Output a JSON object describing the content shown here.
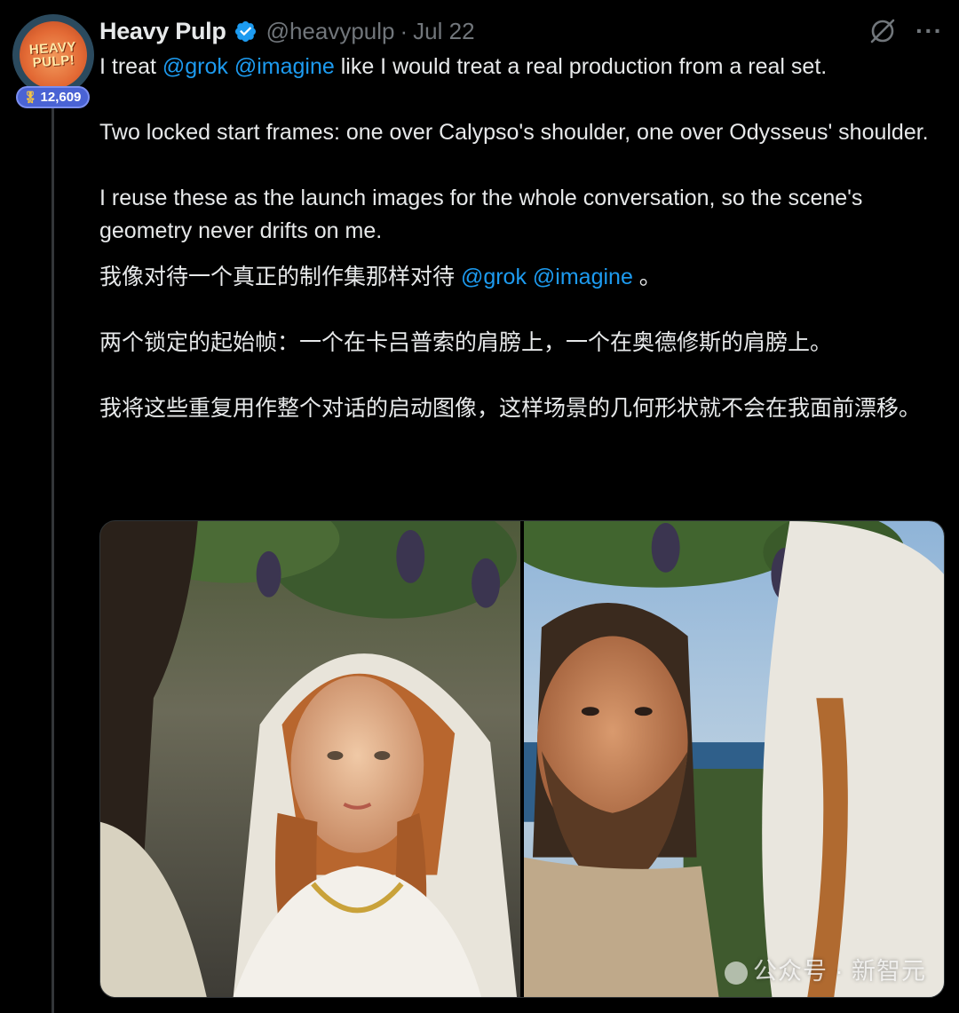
{
  "author": {
    "avatar_text_line1": "HEAVY",
    "avatar_text_line2": "PULP!",
    "name": "Heavy Pulp",
    "handle": "@heavypulp",
    "separator": "·",
    "date": "Jul 22",
    "badge_count": "12,609"
  },
  "icons": {
    "verified": "verified-badge-icon",
    "grok": "grok-icon",
    "more": "more-options-icon",
    "badge": "medal-icon"
  },
  "tweet": {
    "en_line1_pre": "I treat ",
    "mention_grok": "@grok",
    "mention_space": " ",
    "mention_imagine": "@imagine",
    "en_line1_post": " like I would treat a real production from a real set.",
    "en_para2": "Two locked start frames: one over Calypso's shoulder, one over Odysseus' shoulder.",
    "en_para3": "I reuse these as the launch images for the whole conversation, so the scene's geometry never drifts on me.",
    "zh_line1_pre": "我像对待一个真正的制作集那样对待 ",
    "zh_mention_grok": "@grok",
    "zh_mention_imagine": "@imagine",
    "zh_line1_post": " 。",
    "zh_para2": "两个锁定的起始帧：一个在卡吕普索的肩膀上，一个在奥德修斯的肩膀上。",
    "zh_para3": "我将这些重复用作整个对话的启动图像，这样场景的几何形状就不会在我面前漂移。"
  },
  "media": {
    "watermark": "公众号 · 新智元"
  },
  "colors": {
    "background": "#000000",
    "text": "#e7e9ea",
    "secondary": "#71767b",
    "link": "#1d9bf0",
    "verified": "#1d9bf0",
    "badge": "#4a63d4"
  }
}
